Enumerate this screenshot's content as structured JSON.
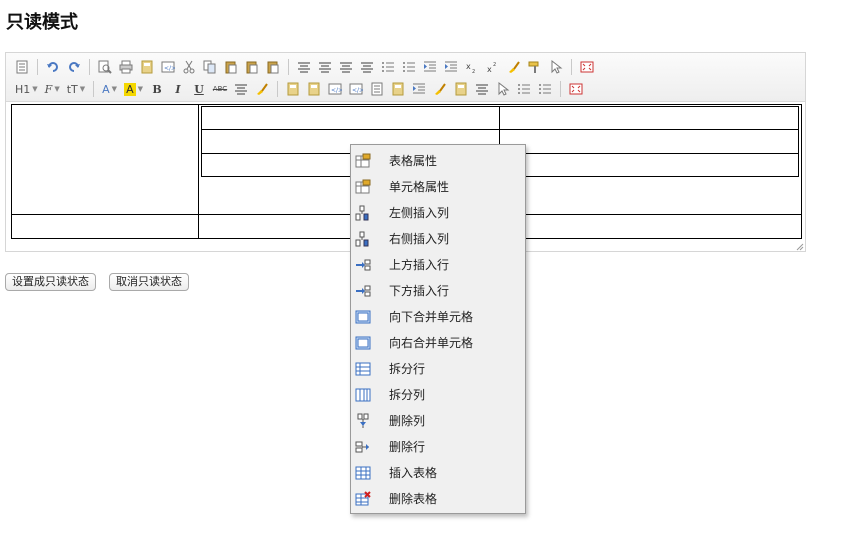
{
  "page": {
    "title": "只读模式"
  },
  "toolbar": {
    "row1": [
      {
        "name": "source-icon",
        "glyph": "doc"
      },
      {
        "sep": true
      },
      {
        "name": "undo-icon",
        "glyph": "undo"
      },
      {
        "name": "redo-icon",
        "glyph": "redo"
      },
      {
        "sep": true
      },
      {
        "name": "preview-icon",
        "glyph": "search"
      },
      {
        "name": "print-icon",
        "glyph": "print"
      },
      {
        "name": "template-icon",
        "glyph": "template"
      },
      {
        "name": "code-icon",
        "glyph": "code"
      },
      {
        "name": "cut-icon",
        "glyph": "cut"
      },
      {
        "name": "copy-icon",
        "glyph": "copy"
      },
      {
        "name": "paste-icon",
        "glyph": "paste"
      },
      {
        "name": "paste-text-icon",
        "glyph": "paste"
      },
      {
        "name": "paste-word-icon",
        "glyph": "paste"
      },
      {
        "sep": true
      },
      {
        "name": "align-left-icon",
        "glyph": "lines"
      },
      {
        "name": "align-center-icon",
        "glyph": "lines"
      },
      {
        "name": "align-right-icon",
        "glyph": "lines"
      },
      {
        "name": "align-justify-icon",
        "glyph": "lines"
      },
      {
        "name": "ordered-list-icon",
        "glyph": "list"
      },
      {
        "name": "unordered-list-icon",
        "glyph": "list"
      },
      {
        "name": "indent-icon",
        "glyph": "indent"
      },
      {
        "name": "outdent-icon",
        "glyph": "indent"
      },
      {
        "name": "subscript-icon",
        "glyph": "sub"
      },
      {
        "name": "superscript-icon",
        "glyph": "sup"
      },
      {
        "name": "clear-format-icon",
        "glyph": "brush"
      },
      {
        "name": "format-painter-icon",
        "glyph": "painter"
      },
      {
        "name": "select-all-icon",
        "glyph": "cursor"
      },
      {
        "sep": true
      },
      {
        "name": "fullscreen-icon",
        "glyph": "full"
      }
    ],
    "row2_labels": {
      "heading": "H1",
      "font_family": "F",
      "font_size": "tT",
      "fore_color": "A",
      "hilite_color": "A",
      "bold": "B",
      "italic": "I",
      "underline": "U",
      "strikethrough": "ABC"
    },
    "row2_icons": [
      "hr-icon",
      "erase-icon",
      "table-icon",
      "insert-row-icon",
      "flash-icon",
      "media-icon",
      "attachment-icon",
      "insert-table-icon",
      "insert-row-after-icon",
      "emotion-icon",
      "image-icon",
      "page-break-icon",
      "anchor-icon",
      "link-icon",
      "unlink-icon",
      "help-icon"
    ],
    "colors": {
      "accent_yellow": "#f5d800",
      "icon_gray": "#7a7a7a",
      "icon_blue": "#4a78c2"
    }
  },
  "buttons": {
    "set_readonly": "设置成只读状态",
    "cancel_readonly": "取消只读状态"
  },
  "context_menu": {
    "items": [
      {
        "label": "表格属性",
        "icon": "table-properties-icon"
      },
      {
        "label": "单元格属性",
        "icon": "cell-properties-icon"
      },
      {
        "label": "左侧插入列",
        "icon": "insert-column-left-icon"
      },
      {
        "label": "右侧插入列",
        "icon": "insert-column-right-icon"
      },
      {
        "label": "上方插入行",
        "icon": "insert-row-above-icon"
      },
      {
        "label": "下方插入行",
        "icon": "insert-row-below-icon"
      },
      {
        "label": "向下合并单元格",
        "icon": "merge-down-icon"
      },
      {
        "label": "向右合并单元格",
        "icon": "merge-right-icon"
      },
      {
        "label": "拆分行",
        "icon": "split-row-icon"
      },
      {
        "label": "拆分列",
        "icon": "split-column-icon"
      },
      {
        "label": "删除列",
        "icon": "delete-column-icon"
      },
      {
        "label": "删除行",
        "icon": "delete-row-icon"
      },
      {
        "label": "插入表格",
        "icon": "insert-table-icon"
      },
      {
        "label": "删除表格",
        "icon": "delete-table-icon"
      }
    ]
  }
}
